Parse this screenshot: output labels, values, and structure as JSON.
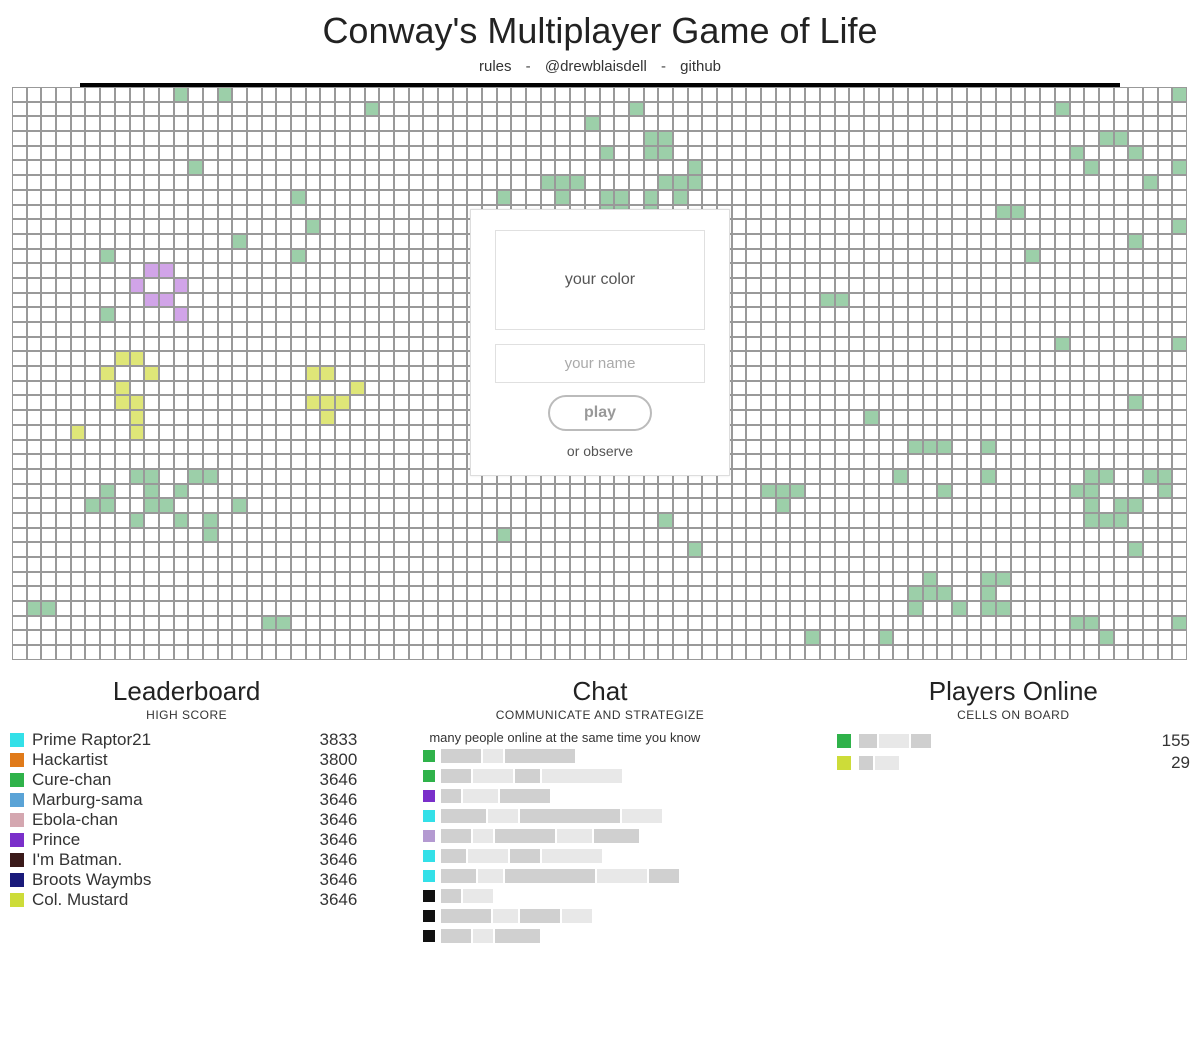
{
  "header": {
    "title": "Conway's Multiplayer Game of Life",
    "links": {
      "rules": "rules",
      "author": "@drewblaisdell",
      "github": "github"
    },
    "sep": "-"
  },
  "onboard": {
    "color_label": "your color",
    "name_placeholder": "your name",
    "play_label": "play",
    "observe_label": "or observe"
  },
  "grid": {
    "cols": 80,
    "rows": 39,
    "cells": [
      "11,0,g",
      "14,0,g",
      "79,0,g",
      "24,1,g",
      "42,1,g",
      "71,1,g",
      "39,2,g",
      "43,3,g",
      "44,3,g",
      "74,3,g",
      "75,3,g",
      "43,4,g",
      "44,4,g",
      "40,4,g",
      "72,4,g",
      "76,4,g",
      "46,5,g",
      "73,5,g",
      "79,5,g",
      "12,5,g",
      "36,6,g",
      "37,6,g",
      "38,6,g",
      "44,6,g",
      "45,6,g",
      "46,6,g",
      "77,6,g",
      "19,7,g",
      "33,7,g",
      "37,7,g",
      "40,7,g",
      "41,7,g",
      "43,7,g",
      "45,7,g",
      "40,8,g",
      "41,8,g",
      "43,8,g",
      "67,8,g",
      "68,8,g",
      "20,9,g",
      "35,9,g",
      "36,9,g",
      "37,9,g",
      "79,9,g",
      "15,10,g",
      "76,10,g",
      "6,11,g",
      "19,11,g",
      "69,11,g",
      "9,12,p",
      "10,12,p",
      "8,13,p",
      "11,13,p",
      "9,14,p",
      "10,14,p",
      "55,14,g",
      "56,14,g",
      "6,15,g",
      "11,15,p",
      "79,17,g",
      "71,17,g",
      "7,18,y",
      "8,18,y",
      "6,19,y",
      "9,19,y",
      "20,19,y",
      "21,19,y",
      "7,20,y",
      "23,20,y",
      "7,21,y",
      "8,21,y",
      "20,21,y",
      "21,21,y",
      "22,21,y",
      "76,21,g",
      "8,22,y",
      "21,22,y",
      "58,22,g",
      "4,23,y",
      "8,23,y",
      "61,24,g",
      "62,24,g",
      "63,24,g",
      "66,24,g",
      "8,26,g",
      "9,26,g",
      "12,26,g",
      "13,26,g",
      "60,26,g",
      "66,26,g",
      "73,26,g",
      "74,26,g",
      "77,26,g",
      "78,26,g",
      "6,27,g",
      "9,27,g",
      "11,27,g",
      "51,27,g",
      "52,27,g",
      "53,27,g",
      "63,27,g",
      "72,27,g",
      "73,27,g",
      "78,27,g",
      "5,28,g",
      "6,28,g",
      "9,28,g",
      "10,28,g",
      "15,28,g",
      "52,28,g",
      "73,28,g",
      "75,28,g",
      "76,28,g",
      "8,29,g",
      "11,29,g",
      "13,29,g",
      "44,29,g",
      "73,29,g",
      "74,29,g",
      "75,29,g",
      "13,30,g",
      "33,30,g",
      "46,31,g",
      "76,31,g",
      "62,33,g",
      "66,33,g",
      "67,33,g",
      "61,34,g",
      "62,34,g",
      "63,34,g",
      "66,34,g",
      "1,35,g",
      "2,35,g",
      "61,35,g",
      "64,35,g",
      "66,35,g",
      "67,35,g",
      "17,36,g",
      "18,36,g",
      "72,36,g",
      "73,36,g",
      "79,36,g",
      "54,37,g",
      "59,37,g",
      "74,37,g"
    ]
  },
  "leaderboard": {
    "title": "Leaderboard",
    "subtitle": "HIGH SCORE",
    "rows": [
      {
        "color": "#33e0e8",
        "name": "Prime Raptor21",
        "score": "3833"
      },
      {
        "color": "#e07a1a",
        "name": "Hackartist",
        "score": "3800"
      },
      {
        "color": "#2fb24a",
        "name": "Cure-chan",
        "score": "3646"
      },
      {
        "color": "#5aa3d6",
        "name": "Marburg-sama",
        "score": "3646"
      },
      {
        "color": "#d4a7b0",
        "name": "Ebola-chan",
        "score": "3646"
      },
      {
        "color": "#7a2fca",
        "name": "Prince",
        "score": "3646"
      },
      {
        "color": "#3a1a1a",
        "name": "I'm Batman.",
        "score": "3646"
      },
      {
        "color": "#1a1a7a",
        "name": "Broots Waymbs",
        "score": "3646"
      },
      {
        "color": "#cddc39",
        "name": "Col. Mustard",
        "score": "3646"
      }
    ]
  },
  "chat": {
    "title": "Chat",
    "subtitle": "COMMUNICATE AND STRATEGIZE",
    "top_message": "many people online at the same time you know",
    "rows": [
      {
        "color": "#2fb24a",
        "widths": [
          40,
          20,
          70
        ]
      },
      {
        "color": "#2fb24a",
        "widths": [
          30,
          40,
          25,
          80
        ]
      },
      {
        "color": "#7a2fca",
        "widths": [
          20,
          35,
          50
        ]
      },
      {
        "color": "#33e0e8",
        "widths": [
          45,
          30,
          100,
          40
        ]
      },
      {
        "color": "#b49ad1",
        "widths": [
          30,
          20,
          60,
          35,
          45
        ]
      },
      {
        "color": "#33e0e8",
        "widths": [
          25,
          40,
          30,
          60
        ]
      },
      {
        "color": "#33e0e8",
        "widths": [
          35,
          25,
          90,
          50,
          30
        ]
      },
      {
        "color": "#111",
        "widths": [
          20,
          30
        ]
      },
      {
        "color": "#111",
        "widths": [
          50,
          25,
          40,
          30
        ]
      },
      {
        "color": "#111",
        "widths": [
          30,
          20,
          45
        ]
      }
    ]
  },
  "online": {
    "title": "Players Online",
    "subtitle": "CELLS ON BOARD",
    "rows": [
      {
        "color": "#2fb24a",
        "blur": [
          18,
          30,
          20
        ],
        "count": "155"
      },
      {
        "color": "#cddc39",
        "blur": [
          14,
          24
        ],
        "count": "29"
      }
    ]
  }
}
